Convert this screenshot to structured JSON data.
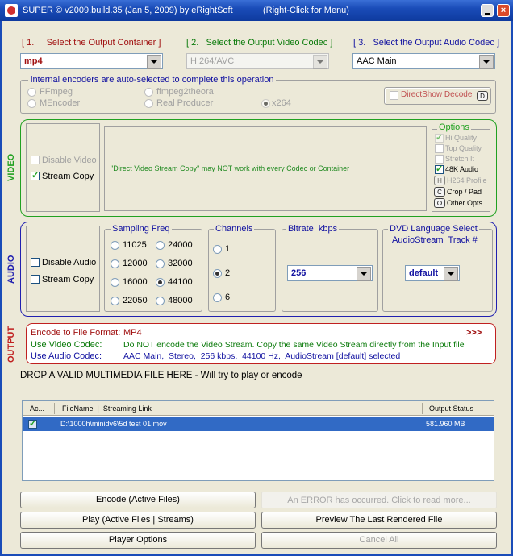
{
  "window": {
    "title": "SUPER © v2009.build.35 (Jan 5, 2009) by eRightSoft",
    "hint": "(Right-Click for Menu)"
  },
  "steps": {
    "container": {
      "label": "[ 1.     Select the Output Container ]",
      "value": "mp4"
    },
    "video_codec": {
      "label": "[ 2.   Select the Output Video Codec ]",
      "value": "H.264/AVC"
    },
    "audio_codec": {
      "label": "[ 3.   Select the Output Audio Codec ]",
      "value": "AAC Main"
    }
  },
  "encoders": {
    "legend": "internal encoders are auto-selected to complete this operation",
    "options": [
      "FFmpeg",
      "ffmpeg2theora",
      "MEncoder",
      "Real Producer",
      "x264"
    ],
    "directshow": "DirectShow Decode",
    "directshow_key": "D"
  },
  "video": {
    "section": "VIDEO",
    "disable": "Disable Video",
    "stream_copy": "Stream Copy",
    "message": "\"Direct Video Stream Copy\" may NOT work with every Codec or Container",
    "options_title": "Options",
    "options": [
      "Hi Quality",
      "Top Quality",
      "Stretch It",
      "48K Audio",
      "H264 Profile",
      "Crop / Pad",
      "Other Opts"
    ],
    "option_keys": [
      "H",
      "C",
      "O"
    ]
  },
  "audio": {
    "section": "AUDIO",
    "disable": "Disable Audio",
    "stream_copy": "Stream Copy",
    "freq_title": "Sampling Freq",
    "freqs": [
      "11025",
      "24000",
      "12000",
      "32000",
      "16000",
      "44100",
      "22050",
      "48000"
    ],
    "channels_title": "Channels",
    "channels": [
      "1",
      "2",
      "6"
    ],
    "bitrate_title": "Bitrate  kbps",
    "bitrate": "256",
    "dvd_title": "DVD Language Select",
    "dvd_title2": "AudioStream  Track #",
    "dvd_value": "default"
  },
  "output": {
    "section": "OUTPUT",
    "format_label": "Encode to File Format:",
    "format_value": "MP4",
    "more": ">>>",
    "video_label": "Use Video Codec:",
    "video_value": "Do NOT encode the Video Stream. Copy the same Video Stream directly from the Input file",
    "audio_label": "Use Audio Codec:",
    "audio_value": "AAC Main,  Stereo,  256 kbps,  44100 Hz,  AudioStream [default] selected"
  },
  "drop_text": "DROP A VALID MULTIMEDIA FILE HERE - Will try to play or encode",
  "file_table": {
    "headers": [
      "Ac...",
      "FileName  |  Streaming Link",
      "Output Status"
    ],
    "rows": [
      {
        "name": "D:\\1000h\\minidv6\\5d test 01.mov",
        "status": "581.960 MB"
      }
    ]
  },
  "buttons": {
    "encode": "Encode (Active Files)",
    "error": "An ERROR has occurred. Click to read more...",
    "play": "Play (Active Files | Streams)",
    "preview": "Preview The Last Rendered File",
    "player_options": "Player Options",
    "cancel": "Cancel All"
  }
}
